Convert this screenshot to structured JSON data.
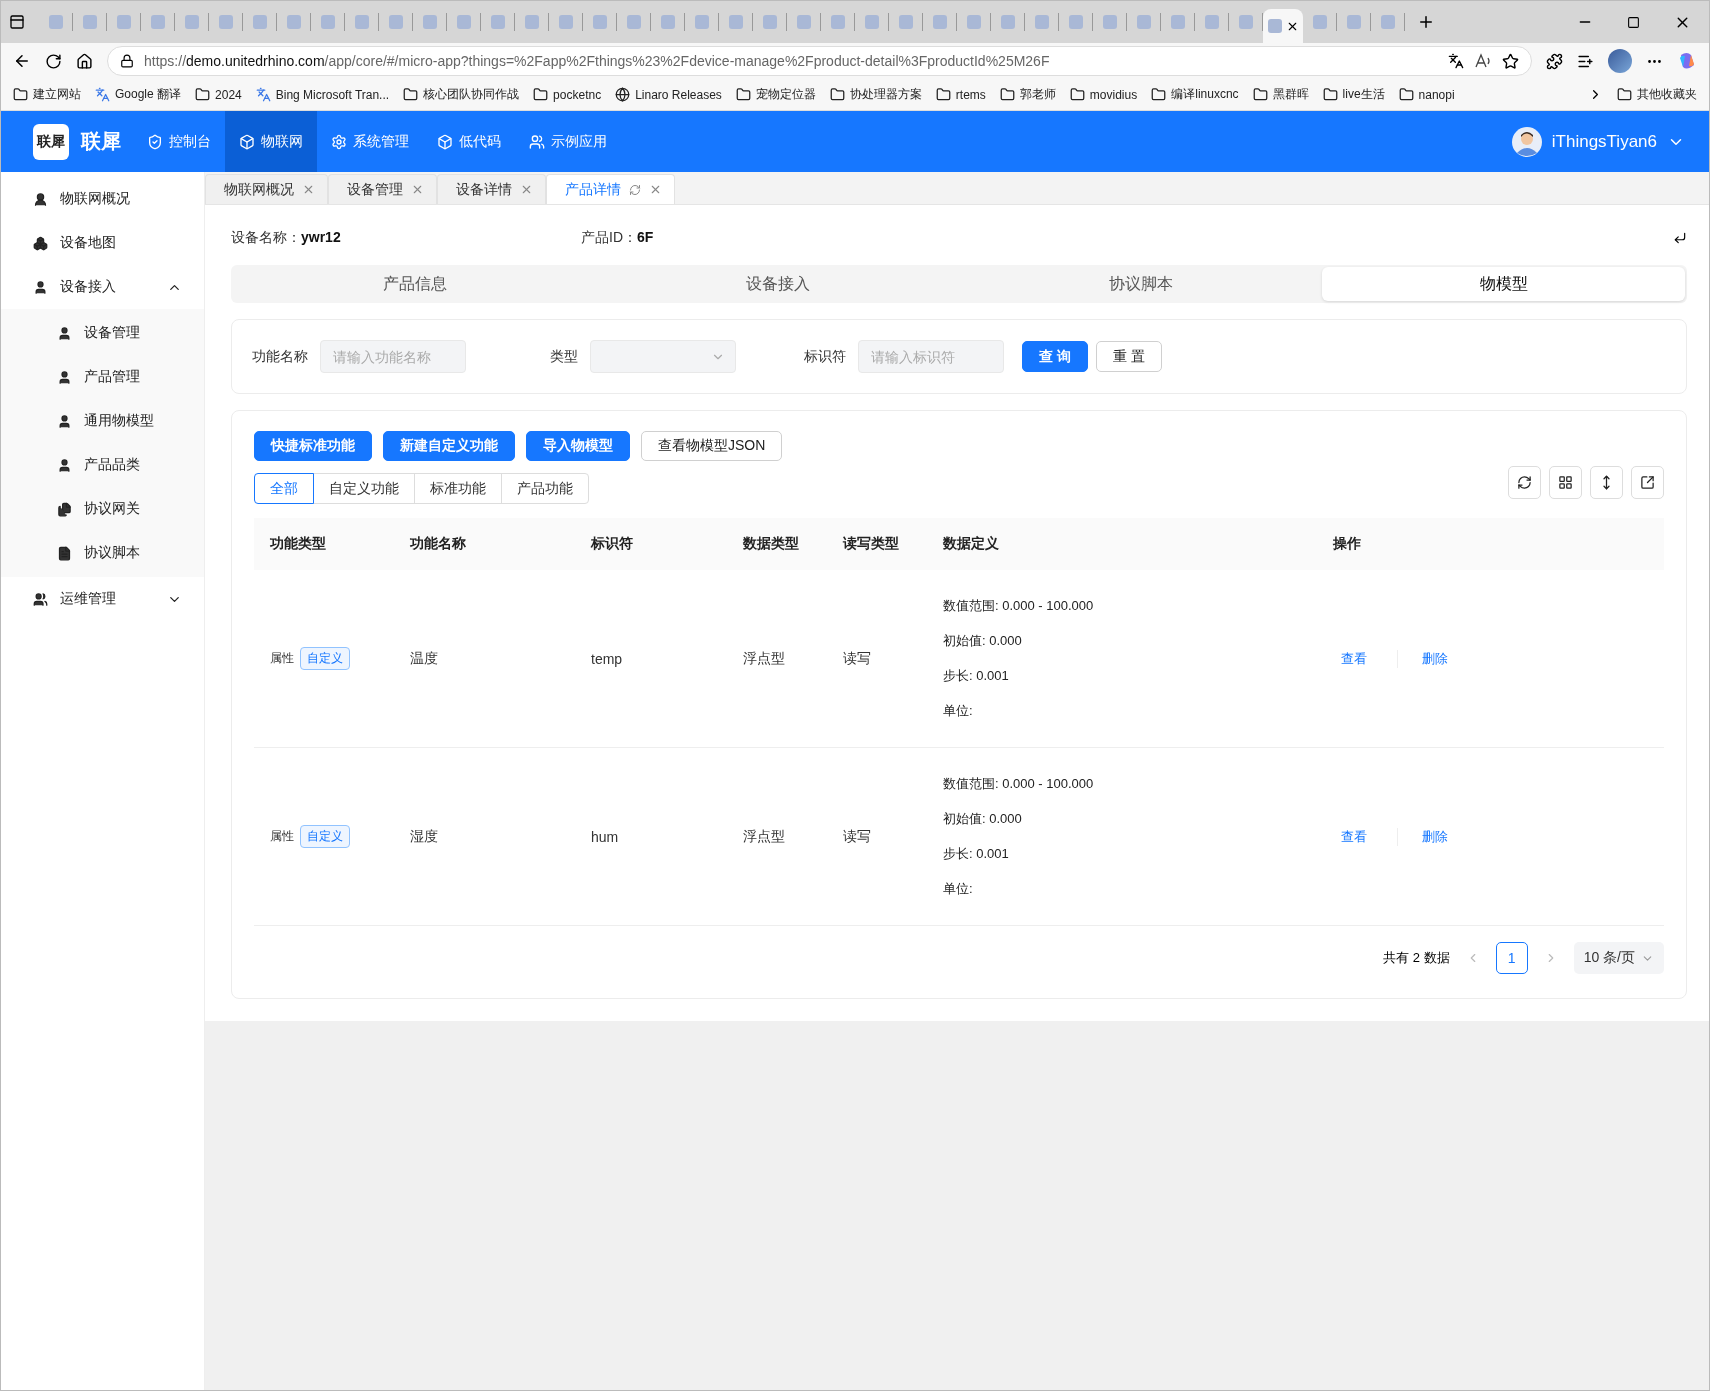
{
  "browser": {
    "tabs": [
      {
        "selected": false
      },
      {
        "selected": false
      },
      {
        "selected": false
      },
      {
        "selected": false
      },
      {
        "selected": false
      },
      {
        "selected": false
      },
      {
        "selected": false
      },
      {
        "selected": false
      },
      {
        "selected": false
      },
      {
        "selected": false
      },
      {
        "selected": false
      },
      {
        "selected": false
      },
      {
        "selected": false
      },
      {
        "selected": false
      },
      {
        "selected": false
      },
      {
        "selected": false
      },
      {
        "selected": false
      },
      {
        "selected": false
      },
      {
        "selected": false
      },
      {
        "selected": false
      },
      {
        "selected": false
      },
      {
        "selected": false
      },
      {
        "selected": false
      },
      {
        "selected": false
      },
      {
        "selected": false
      },
      {
        "selected": false
      },
      {
        "selected": false
      },
      {
        "selected": false
      },
      {
        "selected": false
      },
      {
        "selected": false
      },
      {
        "selected": false
      },
      {
        "selected": false
      },
      {
        "selected": false
      },
      {
        "selected": false
      },
      {
        "selected": false
      },
      {
        "selected": false
      },
      {
        "selected": true
      },
      {
        "selected": false
      },
      {
        "selected": false
      },
      {
        "selected": false
      }
    ],
    "url": "https://**demo.unitedrhino.com**/app/core/#/micro-app?things=%2Fapp%2Fthings%23%2Fdevice-manage%2Fproduct-detail%3FproductId%25M26F",
    "bookmarks": [
      {
        "label": "建立网站",
        "kind": "folder"
      },
      {
        "label": "Google 翻译",
        "kind": "translate"
      },
      {
        "label": "2024",
        "kind": "folder"
      },
      {
        "label": "Bing Microsoft Tran...",
        "kind": "translate"
      },
      {
        "label": "核心团队协同作战",
        "kind": "folder"
      },
      {
        "label": "pocketnc",
        "kind": "folder"
      },
      {
        "label": "Linaro Releases",
        "kind": "globe"
      },
      {
        "label": "宠物定位器",
        "kind": "folder"
      },
      {
        "label": "协处理器方案",
        "kind": "folder"
      },
      {
        "label": "rtems",
        "kind": "folder"
      },
      {
        "label": "郭老师",
        "kind": "folder"
      },
      {
        "label": "movidius",
        "kind": "folder"
      },
      {
        "label": "编译linuxcnc",
        "kind": "folder"
      },
      {
        "label": "黑群晖",
        "kind": "folder"
      },
      {
        "label": "live生活",
        "kind": "folder"
      },
      {
        "label": "nanopi",
        "kind": "folder"
      }
    ],
    "other_bookmarks": "其他收藏夹"
  },
  "app": {
    "logo": "联犀",
    "title": "联犀",
    "nav": [
      {
        "label": "控制台",
        "kind": "shield",
        "selected": false
      },
      {
        "label": "物联网",
        "kind": "box",
        "selected": true
      },
      {
        "label": "系统管理",
        "kind": "gear",
        "selected": false
      },
      {
        "label": "低代码",
        "kind": "box",
        "selected": false
      },
      {
        "label": "示例应用",
        "kind": "users",
        "selected": false
      }
    ],
    "user": "iThingsTiyan6"
  },
  "sidebar": [
    {
      "label": "物联网概况",
      "kind": "user-list"
    },
    {
      "label": "设备地图",
      "kind": "cubes"
    },
    {
      "label": "设备接入",
      "kind": "user",
      "expanded": true,
      "children": [
        {
          "label": "设备管理",
          "kind": "user"
        },
        {
          "label": "产品管理",
          "kind": "user"
        },
        {
          "label": "通用物模型",
          "kind": "user"
        },
        {
          "label": "产品品类",
          "kind": "user"
        },
        {
          "label": "协议网关",
          "kind": "docs"
        },
        {
          "label": "协议脚本",
          "kind": "doc"
        }
      ]
    },
    {
      "label": "运维管理",
      "kind": "users",
      "expanded": false
    }
  ],
  "page_tabs": [
    {
      "label": "物联网概况",
      "selected": false
    },
    {
      "label": "设备管理",
      "selected": false
    },
    {
      "label": "设备详情",
      "selected": false
    },
    {
      "label": "产品详情",
      "selected": true
    }
  ],
  "info": [
    {
      "label": "设备名称：",
      "value": "ywr12"
    },
    {
      "label": "产品ID：",
      "value": "6F"
    }
  ],
  "segments": [
    {
      "label": "产品信息",
      "selected": false
    },
    {
      "label": "设备接入",
      "selected": false
    },
    {
      "label": "协议脚本",
      "selected": false
    },
    {
      "label": "物模型",
      "selected": true
    }
  ],
  "filters": {
    "fields": [
      {
        "label": "功能名称",
        "kind": "input",
        "placeholder": "请输入功能名称"
      },
      {
        "label": "类型",
        "kind": "select"
      },
      {
        "label": "标识符",
        "kind": "input",
        "placeholder": "请输入标识符"
      }
    ],
    "buttons": [
      {
        "label": "查 询",
        "kind": "primary"
      },
      {
        "label": "重 置",
        "kind": "default"
      }
    ]
  },
  "actions": [
    {
      "label": "快捷标准功能",
      "kind": "primary"
    },
    {
      "label": "新建自定义功能",
      "kind": "primary"
    },
    {
      "label": "导入物模型",
      "kind": "primary"
    },
    {
      "label": "查看物模型JSON",
      "kind": "default"
    }
  ],
  "type_tabs": [
    {
      "label": "全部",
      "selected": true
    },
    {
      "label": "自定义功能",
      "selected": false
    },
    {
      "label": "标准功能",
      "selected": false
    },
    {
      "label": "产品功能",
      "selected": false
    }
  ],
  "table": {
    "columns": [
      "功能类型",
      "功能名称",
      "标识符",
      "数据类型",
      "读写类型",
      "数据定义",
      "操作"
    ],
    "rows": [
      {
        "type": "属性",
        "tag": "自定义",
        "name": "温度",
        "identifier": "temp",
        "data_type": "浮点型",
        "rw": "读写",
        "definition": [
          "数值范围: 0.000 - 100.000",
          "初始值: 0.000",
          "步长: 0.001",
          "单位:"
        ],
        "actions": [
          "查看",
          "删除"
        ]
      },
      {
        "type": "属性",
        "tag": "自定义",
        "name": "湿度",
        "identifier": "hum",
        "data_type": "浮点型",
        "rw": "读写",
        "definition": [
          "数值范围: 0.000 - 100.000",
          "初始值: 0.000",
          "步长: 0.001",
          "单位:"
        ],
        "actions": [
          "查看",
          "删除"
        ]
      }
    ]
  },
  "pagination": {
    "total": "共有 2 数据",
    "pages": [
      {
        "label": "1",
        "selected": true
      }
    ],
    "page_size": "10 条/页"
  }
}
